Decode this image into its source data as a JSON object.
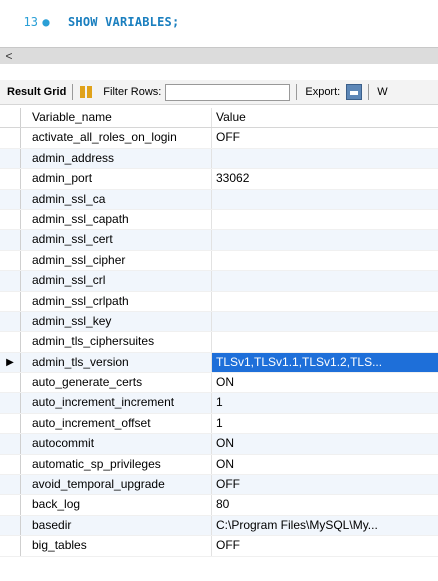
{
  "editor": {
    "line_number": "13",
    "marker": "●",
    "code": "SHOW VARIABLES;"
  },
  "scrollbar": {
    "left_arrow": "<"
  },
  "toolbar": {
    "result_grid_label": "Result Grid",
    "filter_label": "Filter Rows:",
    "filter_value": "",
    "export_label": "Export:",
    "trailing_text": "W"
  },
  "grid": {
    "columns": [
      "Variable_name",
      "Value"
    ],
    "rows": [
      {
        "name": "activate_all_roles_on_login",
        "value": "OFF"
      },
      {
        "name": "admin_address",
        "value": ""
      },
      {
        "name": "admin_port",
        "value": "33062"
      },
      {
        "name": "admin_ssl_ca",
        "value": ""
      },
      {
        "name": "admin_ssl_capath",
        "value": ""
      },
      {
        "name": "admin_ssl_cert",
        "value": ""
      },
      {
        "name": "admin_ssl_cipher",
        "value": ""
      },
      {
        "name": "admin_ssl_crl",
        "value": ""
      },
      {
        "name": "admin_ssl_crlpath",
        "value": ""
      },
      {
        "name": "admin_ssl_key",
        "value": ""
      },
      {
        "name": "admin_tls_ciphersuites",
        "value": ""
      },
      {
        "name": "admin_tls_version",
        "value": "TLSv1,TLSv1.1,TLSv1.2,TLS..."
      },
      {
        "name": "auto_generate_certs",
        "value": "ON"
      },
      {
        "name": "auto_increment_increment",
        "value": "1"
      },
      {
        "name": "auto_increment_offset",
        "value": "1"
      },
      {
        "name": "autocommit",
        "value": "ON"
      },
      {
        "name": "automatic_sp_privileges",
        "value": "ON"
      },
      {
        "name": "avoid_temporal_upgrade",
        "value": "OFF"
      },
      {
        "name": "back_log",
        "value": "80"
      },
      {
        "name": "basedir",
        "value": "C:\\Program Files\\MySQL\\My..."
      },
      {
        "name": "big_tables",
        "value": "OFF"
      }
    ],
    "selected_marker": "▶"
  },
  "colors": {
    "selection": "#1e6fd9",
    "alt_row": "#f1f6fc",
    "accent": "#2a9fd6"
  }
}
